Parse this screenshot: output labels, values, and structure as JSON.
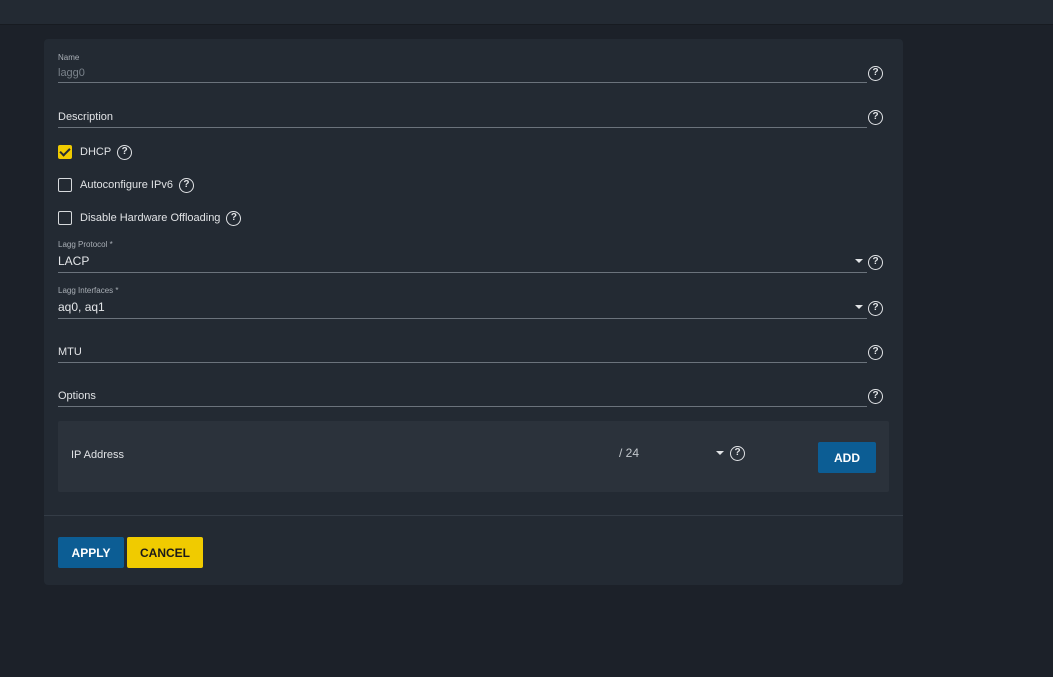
{
  "form": {
    "name": {
      "label": "Name",
      "value": "lagg0"
    },
    "description": {
      "placeholder": "Description"
    },
    "dhcp": {
      "label": "DHCP",
      "checked": true
    },
    "autoconfigure_ipv6": {
      "label": "Autoconfigure IPv6",
      "checked": false
    },
    "disable_hw_offloading": {
      "label": "Disable Hardware Offloading",
      "checked": false
    },
    "lagg_protocol": {
      "label": "Lagg Protocol *",
      "value": "LACP"
    },
    "lagg_interfaces": {
      "label": "Lagg Interfaces *",
      "value": "aq0, aq1"
    },
    "mtu": {
      "placeholder": "MTU"
    },
    "options": {
      "placeholder": "Options"
    },
    "ip_address": {
      "placeholder": "IP Address",
      "netmask": "/ 24",
      "add_label": "ADD"
    }
  },
  "actions": {
    "apply_label": "APPLY",
    "cancel_label": "CANCEL"
  },
  "colors": {
    "background": "#1c2129",
    "card": "#232a33",
    "primary": "#0c5d94",
    "accent": "#f0cb00"
  },
  "icons": {
    "help": "help-circle-icon",
    "dropdown": "caret-down-icon",
    "check": "check-icon"
  }
}
